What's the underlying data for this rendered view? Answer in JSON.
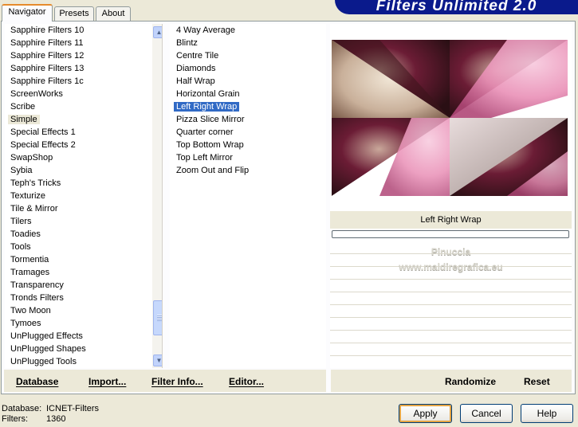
{
  "tabs": [
    "Navigator",
    "Presets",
    "About"
  ],
  "banner_title": "Filters Unlimited 2.0",
  "categories": [
    "Sapphire Filters 10",
    "Sapphire Filters 11",
    "Sapphire Filters 12",
    "Sapphire Filters 13",
    "Sapphire Filters 1c",
    "ScreenWorks",
    "Scribe",
    "Simple",
    "Special Effects 1",
    "Special Effects 2",
    "SwapShop",
    "Sybia",
    "Teph's Tricks",
    "Texturize",
    "Tile & Mirror",
    "Tilers",
    "Toadies",
    "Tools",
    "Tormentia",
    "Tramages",
    "Transparency",
    "Tronds Filters",
    "Two Moon",
    "Tymoes",
    "UnPlugged Effects",
    "UnPlugged Shapes",
    "UnPlugged Tools"
  ],
  "current_category": "Simple",
  "filters": [
    "4 Way Average",
    "Blintz",
    "Centre Tile",
    "Diamonds",
    "Half Wrap",
    "Horizontal Grain",
    "Left Right Wrap",
    "Pizza Slice Mirror",
    "Quarter corner",
    "Top Bottom Wrap",
    "Top Left Mirror",
    "Zoom Out and Flip"
  ],
  "selected_filter": "Left Right Wrap",
  "toolbar_left": {
    "database": "Database",
    "import": "Import...",
    "filter_info": "Filter Info...",
    "editor": "Editor..."
  },
  "toolbar_right": {
    "randomize": "Randomize",
    "reset": "Reset"
  },
  "preview": {
    "filter_name": "Left Right Wrap",
    "progress": 0,
    "watermark_line1": "Pinuccia",
    "watermark_line2": "www.maldiregrafica.eu"
  },
  "status": {
    "database_label": "Database:",
    "database_value": "ICNET-Filters",
    "filters_label": "Filters:",
    "filters_value": "1360"
  },
  "buttons": {
    "apply": "Apply",
    "cancel": "Cancel",
    "help": "Help"
  },
  "colors": {
    "selection": "#316ac5",
    "banner": "#0a1a8c",
    "tab_accent": "#e68b2c"
  }
}
